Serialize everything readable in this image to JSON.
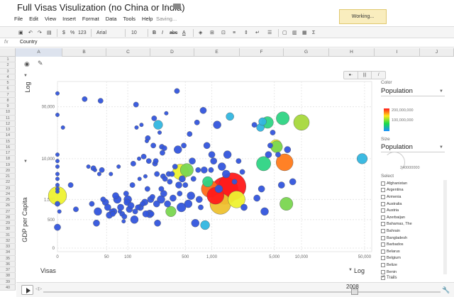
{
  "title": "Full Visas Visulization (no China or India)",
  "working_badge": "Working...",
  "saving": "Saving...",
  "menu": [
    "File",
    "Edit",
    "View",
    "Insert",
    "Format",
    "Data",
    "Tools",
    "Help"
  ],
  "toolbar": {
    "currency": "$",
    "percent": "%",
    "format123": "123",
    "font": "Arial",
    "font_size": "10",
    "bold": "B",
    "italic": "I",
    "strike": "abc",
    "text_color": "A",
    "sigma": "Σ"
  },
  "formula": {
    "label": "fx",
    "value": "Country"
  },
  "columns": [
    "A",
    "B",
    "C",
    "D",
    "E",
    "F",
    "G",
    "H",
    "I",
    "J"
  ],
  "rows": [
    "1",
    "2",
    "3",
    "4",
    "5",
    "6",
    "7",
    "8",
    "9",
    "10",
    "11",
    "12",
    "13",
    "14",
    "15",
    "16",
    "17",
    "18",
    "19",
    "20",
    "21",
    "22",
    "23",
    "24",
    "25",
    "26",
    "27",
    "28",
    "29",
    "30",
    "31",
    "32",
    "33",
    "34",
    "35",
    "36",
    "37",
    "38",
    "39",
    "40"
  ],
  "chart": {
    "y_scale": "Log",
    "y_title": "GDP per Capita",
    "x_title": "Visas",
    "x_scale": "Log",
    "year": "2008",
    "view_toggle": [
      "●·",
      "|||",
      "/"
    ]
  },
  "panel": {
    "color_label": "Color",
    "color_value": "Population",
    "color_max": "200,000,000",
    "color_mid": "100,000,000",
    "size_label": "Size",
    "size_value": "Population",
    "size_max": "240000000",
    "select_label": "Select",
    "countries": [
      "Afghanistan",
      "Argentina",
      "Armenia",
      "Australia",
      "Austria",
      "Azerbaijan",
      "Bahamas, The",
      "Bahrain",
      "Bangladesh",
      "Barbados",
      "Belarus",
      "Belgium",
      "Belize",
      "Benin"
    ],
    "trails_label": "Trails"
  },
  "chart_data": {
    "type": "scatter",
    "x_ticks": [
      "0",
      "50",
      "100",
      "500",
      "1,000",
      "5,000",
      "10,000",
      "50,000"
    ],
    "x_tick_values": [
      0,
      50,
      100,
      500,
      1000,
      5000,
      10000,
      50000
    ],
    "y_ticks": [
      "100,000",
      "10,000",
      "1,500",
      "500",
      "0"
    ],
    "y_tick_values": [
      100000,
      10000,
      1500,
      500,
      0
    ],
    "ylabel": "GDP per Capita",
    "xlabel": "Visas",
    "scale": "log",
    "grid": true,
    "points": [
      [
        0,
        180000,
        3,
        "#3355dd"
      ],
      [
        0,
        70000,
        3,
        "#3355dd"
      ],
      [
        0,
        12000,
        3,
        "#3355dd"
      ],
      [
        0,
        9000,
        3,
        "#3355dd"
      ],
      [
        0,
        7000,
        3,
        "#3355dd"
      ],
      [
        0,
        5000,
        3,
        "#3355dd"
      ],
      [
        0,
        4000,
        3,
        "#3355dd"
      ],
      [
        0,
        3000,
        3,
        "#3355dd"
      ],
      [
        0,
        2500,
        3,
        "#3355dd"
      ],
      [
        0,
        2200,
        3,
        "#3355dd"
      ],
      [
        0,
        1800,
        14,
        "#eef230"
      ],
      [
        0,
        1200,
        4,
        "#3355dd"
      ],
      [
        0,
        300,
        5,
        "#3355dd"
      ],
      [
        1,
        800,
        3,
        "#3355dd"
      ],
      [
        3,
        40000,
        3,
        "#3355dd"
      ],
      [
        8,
        3000,
        4,
        "#3355dd"
      ],
      [
        12,
        900,
        4,
        "#3355dd"
      ],
      [
        20,
        140000,
        4,
        "#3355dd"
      ],
      [
        24,
        7000,
        3,
        "#3355dd"
      ],
      [
        28,
        1200,
        4,
        "#3355dd"
      ],
      [
        30,
        6500,
        4,
        "#3355dd"
      ],
      [
        32,
        6000,
        3,
        "#3355dd"
      ],
      [
        34,
        400,
        5,
        "#3355dd"
      ],
      [
        36,
        800,
        6,
        "#3355dd"
      ],
      [
        38,
        5000,
        3,
        "#3355dd"
      ],
      [
        40,
        130000,
        4,
        "#3355dd"
      ],
      [
        42,
        6000,
        4,
        "#3355dd"
      ],
      [
        44,
        1500,
        4,
        "#3355dd"
      ],
      [
        48,
        1300,
        5,
        "#3355dd"
      ],
      [
        52,
        1000,
        5,
        "#3355dd"
      ],
      [
        55,
        650,
        5,
        "#3355dd"
      ],
      [
        58,
        5000,
        3,
        "#3355dd"
      ],
      [
        60,
        800,
        4,
        "#3355dd"
      ],
      [
        62,
        700,
        4,
        "#3355dd"
      ],
      [
        64,
        800,
        5,
        "#3355dd"
      ],
      [
        68,
        1800,
        5,
        "#3355dd"
      ],
      [
        72,
        1500,
        6,
        "#3355dd"
      ],
      [
        75,
        7000,
        3,
        "#3355dd"
      ],
      [
        78,
        800,
        3,
        "#3355dd"
      ],
      [
        80,
        1000,
        5,
        "#3355dd"
      ],
      [
        84,
        700,
        4,
        "#3355dd"
      ],
      [
        88,
        450,
        3,
        "#3355dd"
      ],
      [
        90,
        600,
        4,
        "#3355dd"
      ],
      [
        95,
        2000,
        4,
        "#3355dd"
      ],
      [
        98,
        1300,
        5,
        "#3355dd"
      ],
      [
        100,
        1500,
        6,
        "#3355dd"
      ],
      [
        105,
        900,
        5,
        "#3355dd"
      ],
      [
        110,
        1100,
        5,
        "#3355dd"
      ],
      [
        115,
        3000,
        4,
        "#3355dd"
      ],
      [
        118,
        8000,
        4,
        "#3355dd"
      ],
      [
        122,
        500,
        6,
        "#3355dd"
      ],
      [
        125,
        800,
        4,
        "#3355dd"
      ],
      [
        128,
        110000,
        4,
        "#3355dd"
      ],
      [
        130,
        40000,
        3,
        "#3355dd"
      ],
      [
        135,
        1000,
        4,
        "#3355dd"
      ],
      [
        140,
        10000,
        3,
        "#3355dd"
      ],
      [
        142,
        4000,
        3,
        "#3355dd"
      ],
      [
        145,
        1000,
        5,
        "#3355dd"
      ],
      [
        150,
        45000,
        3,
        "#3355dd"
      ],
      [
        155,
        1200,
        4,
        "#3355dd"
      ],
      [
        160,
        11000,
        4,
        "#3355dd"
      ],
      [
        165,
        1300,
        5,
        "#3355dd"
      ],
      [
        168,
        4500,
        3,
        "#3355dd"
      ],
      [
        170,
        700,
        5,
        "#3355dd"
      ],
      [
        175,
        22000,
        3,
        "#3355dd"
      ],
      [
        178,
        2500,
        4,
        "#3355dd"
      ],
      [
        180,
        25000,
        4,
        "#3355dd"
      ],
      [
        185,
        9000,
        4,
        "#3355dd"
      ],
      [
        190,
        700,
        6,
        "#3355dd"
      ],
      [
        195,
        1500,
        5,
        "#3355dd"
      ],
      [
        200,
        700,
        4,
        "#3355dd"
      ],
      [
        205,
        1700,
        4,
        "#3355dd"
      ],
      [
        210,
        18000,
        4,
        "#3355dd"
      ],
      [
        215,
        60000,
        4,
        "#3355dd"
      ],
      [
        220,
        8000,
        4,
        "#3355dd"
      ],
      [
        225,
        9000,
        4,
        "#3355dd"
      ],
      [
        230,
        1200,
        5,
        "#3355dd"
      ],
      [
        232,
        5000,
        4,
        "#3355dd"
      ],
      [
        236,
        400,
        5,
        "#3355dd"
      ],
      [
        240,
        45000,
        7,
        "#31b6e0"
      ],
      [
        250,
        32000,
        3,
        "#3355dd"
      ],
      [
        260,
        1500,
        6,
        "#3355dd"
      ],
      [
        262,
        2500,
        4,
        "#3355dd"
      ],
      [
        266,
        17000,
        4,
        "#3355dd"
      ],
      [
        270,
        13000,
        4,
        "#3355dd"
      ],
      [
        275,
        4500,
        4,
        "#3355dd"
      ],
      [
        280,
        2000,
        5,
        "#3355dd"
      ],
      [
        285,
        16000,
        4,
        "#3355dd"
      ],
      [
        290,
        4000,
        4,
        "#3355dd"
      ],
      [
        300,
        75000,
        3,
        "#3355dd"
      ],
      [
        310,
        1200,
        5,
        "#3355dd"
      ],
      [
        320,
        5000,
        4,
        "#3355dd"
      ],
      [
        330,
        3500,
        4,
        "#3355dd"
      ],
      [
        340,
        800,
        8,
        "#7ad650"
      ],
      [
        350,
        5000,
        4,
        "#3355dd"
      ],
      [
        360,
        1600,
        5,
        "#3355dd"
      ],
      [
        380,
        7000,
        4,
        "#3355dd"
      ],
      [
        400,
        200000,
        4,
        "#3355dd"
      ],
      [
        410,
        15000,
        6,
        "#3355dd"
      ],
      [
        420,
        3000,
        5,
        "#3355dd"
      ],
      [
        430,
        2000,
        4,
        "#3355dd"
      ],
      [
        440,
        5500,
        12,
        "#eef230"
      ],
      [
        450,
        1000,
        7,
        "#3355dd"
      ],
      [
        460,
        4000,
        5,
        "#3355dd"
      ],
      [
        480,
        18000,
        4,
        "#3355dd"
      ],
      [
        500,
        3000,
        4,
        "#3355dd"
      ],
      [
        520,
        6000,
        10,
        "#7ad650"
      ],
      [
        540,
        1200,
        6,
        "#3355dd"
      ],
      [
        560,
        30000,
        4,
        "#3355dd"
      ],
      [
        580,
        1800,
        6,
        "#3355dd"
      ],
      [
        600,
        9000,
        5,
        "#3355dd"
      ],
      [
        620,
        4000,
        4,
        "#3355dd"
      ],
      [
        650,
        400,
        6,
        "#3355dd"
      ],
      [
        680,
        50000,
        4,
        "#3355dd"
      ],
      [
        700,
        6000,
        4,
        "#3355dd"
      ],
      [
        720,
        1500,
        5,
        "#3355dd"
      ],
      [
        750,
        1000,
        4,
        "#3355dd"
      ],
      [
        800,
        85000,
        5,
        "#3355dd"
      ],
      [
        820,
        6000,
        5,
        "#3355dd"
      ],
      [
        840,
        350,
        7,
        "#31b6e0"
      ],
      [
        880,
        18000,
        5,
        "#3355dd"
      ],
      [
        900,
        3500,
        8,
        "#2ed484"
      ],
      [
        950,
        2500,
        13,
        "#ff6a1a"
      ],
      [
        980,
        6000,
        4,
        "#3355dd"
      ],
      [
        1000,
        12000,
        5,
        "#3355dd"
      ],
      [
        1050,
        9000,
        5,
        "#3355dd"
      ],
      [
        1100,
        1800,
        13,
        "#ff1a1a"
      ],
      [
        1150,
        45000,
        6,
        "#3355dd"
      ],
      [
        1200,
        2500,
        6,
        "#3355dd"
      ],
      [
        1250,
        1200,
        16,
        "#eec230"
      ],
      [
        1300,
        7000,
        6,
        "#3355dd"
      ],
      [
        1400,
        2300,
        21,
        "#ff1a1a"
      ],
      [
        1450,
        5000,
        6,
        "#3355dd"
      ],
      [
        1500,
        12000,
        6,
        "#3355dd"
      ],
      [
        1600,
        65000,
        6,
        "#31b6e0"
      ],
      [
        1700,
        2800,
        21,
        "#ff1a1a"
      ],
      [
        1800,
        3500,
        4,
        "#3355dd"
      ],
      [
        1900,
        1500,
        13,
        "#eef230"
      ],
      [
        2000,
        9000,
        4,
        "#3355dd"
      ],
      [
        2200,
        5500,
        4,
        "#3355dd"
      ],
      [
        2300,
        1000,
        5,
        "#3355dd"
      ],
      [
        3000,
        45000,
        4,
        "#3355dd"
      ],
      [
        3200,
        1600,
        5,
        "#3355dd"
      ],
      [
        3500,
        40000,
        6,
        "#31b6e0"
      ],
      [
        3600,
        2500,
        5,
        "#3355dd"
      ],
      [
        3700,
        52000,
        6,
        "#31b6e0"
      ],
      [
        3800,
        8000,
        11,
        "#2ed484"
      ],
      [
        3900,
        800,
        6,
        "#3355dd"
      ],
      [
        4200,
        50000,
        9,
        "#2ed484"
      ],
      [
        4300,
        12000,
        5,
        "#3355dd"
      ],
      [
        4500,
        18000,
        4,
        "#3355dd"
      ],
      [
        4800,
        32000,
        4,
        "#3355dd"
      ],
      [
        5200,
        18000,
        9,
        "#eef230"
      ],
      [
        5300,
        17000,
        9,
        "#7ad650"
      ],
      [
        5500,
        12000,
        4,
        "#3355dd"
      ],
      [
        6000,
        3000,
        5,
        "#3355dd"
      ],
      [
        6200,
        60000,
        10,
        "#2ed484"
      ],
      [
        6500,
        8500,
        13,
        "#ff7a1a"
      ],
      [
        6800,
        1200,
        10,
        "#7ad650"
      ],
      [
        7000,
        15000,
        5,
        "#3355dd"
      ],
      [
        8000,
        3500,
        5,
        "#3355dd"
      ],
      [
        10000,
        50000,
        12,
        "#a6d83c"
      ],
      [
        47000,
        10000,
        8,
        "#31b6e0"
      ]
    ]
  }
}
